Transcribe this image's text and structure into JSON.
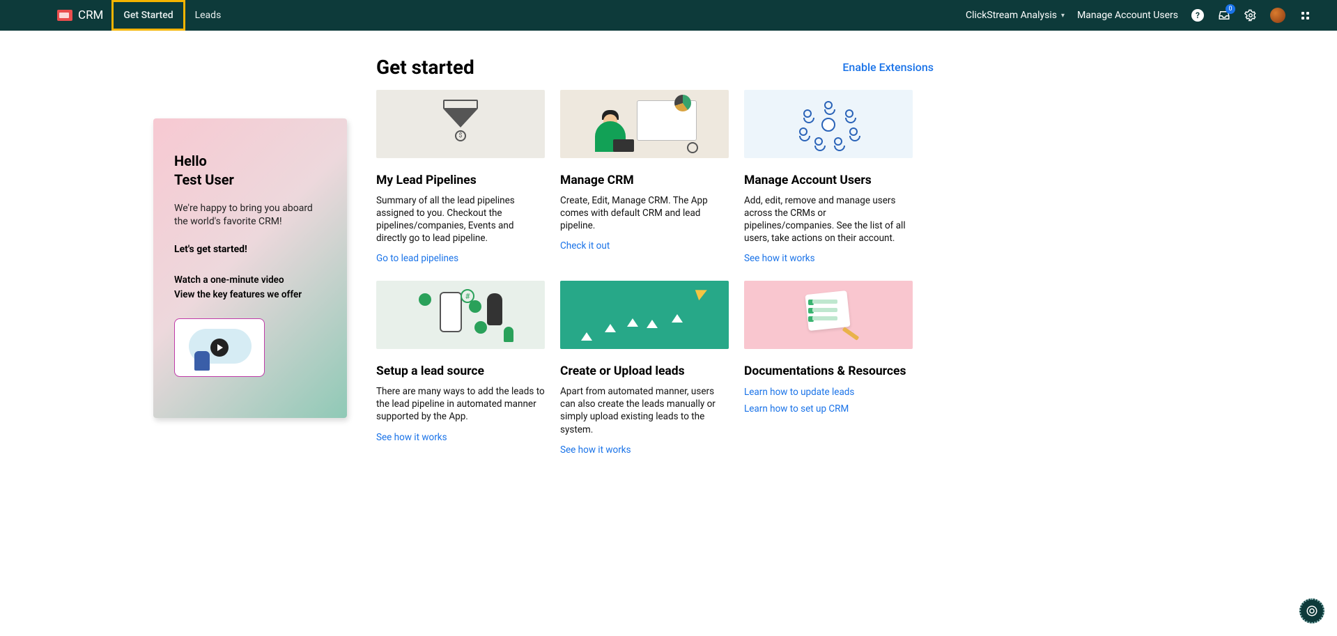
{
  "brand": "CRM",
  "tabs": [
    "Get Started",
    "Leads"
  ],
  "topnav": {
    "clickstream": "ClickStream Analysis",
    "manage_users": "Manage Account Users",
    "inbox_badge": "0"
  },
  "welcome": {
    "hello": "Hello",
    "user": "Test User",
    "msg": "We're happy to bring you aboard the world's favorite CRM!",
    "getstarted": "Let's get started!",
    "watch": "Watch a one-minute video",
    "features": "View the key features we offer"
  },
  "page_title": "Get started",
  "enable_ext": "Enable Extensions",
  "cards": [
    {
      "title": "My Lead Pipelines",
      "desc": "Summary of all the lead pipelines assigned to you. Checkout the pipelines/companies, Events and directly go to lead pipeline.",
      "links": [
        "Go to lead pipelines"
      ]
    },
    {
      "title": "Manage CRM",
      "desc": "Create, Edit, Manage CRM. The App comes with default CRM and lead pipeline.",
      "links": [
        "Check it out"
      ]
    },
    {
      "title": "Manage Account Users",
      "desc": "Add, edit, remove and manage users across the CRMs or pipelines/companies. See the list of all users, take actions on their account.",
      "links": [
        "See how it works"
      ]
    },
    {
      "title": "Setup a lead source",
      "desc": "There are many ways to add the leads to the lead pipeline in automated manner supported by the App.",
      "links": [
        "See how it works"
      ]
    },
    {
      "title": "Create or Upload leads",
      "desc": "Apart from automated manner, users can also create the leads manually or simply upload existing leads to the system.",
      "links": [
        "See how it works"
      ]
    },
    {
      "title": "Documentations & Resources",
      "desc": "",
      "links": [
        "Learn how to update leads",
        "Learn how to set up CRM"
      ]
    }
  ]
}
